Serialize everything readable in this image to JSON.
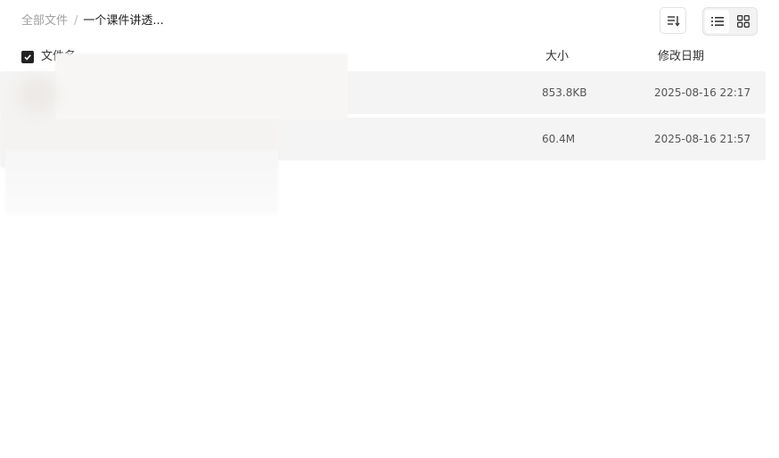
{
  "breadcrumb": {
    "root": "全部文件",
    "separator": "/",
    "current": "一个课件讲透..."
  },
  "toolbar": {
    "sort_icon": "sort-icon",
    "list_view_icon": "list-view-icon",
    "grid_view_icon": "grid-view-icon",
    "active_view": "list"
  },
  "table": {
    "columns": {
      "name": "文件名",
      "size": "大小",
      "date": "修改日期"
    },
    "select_all_checked": true,
    "rows": [
      {
        "size": "853.8KB",
        "date": "2025-08-16 22:17"
      },
      {
        "size": "60.4M",
        "date": "2025-08-16 21:57"
      }
    ]
  },
  "colors": {
    "row_background": "#f4f4f4",
    "checkbox_fill": "#222222",
    "muted_text": "#a0a0a0"
  }
}
